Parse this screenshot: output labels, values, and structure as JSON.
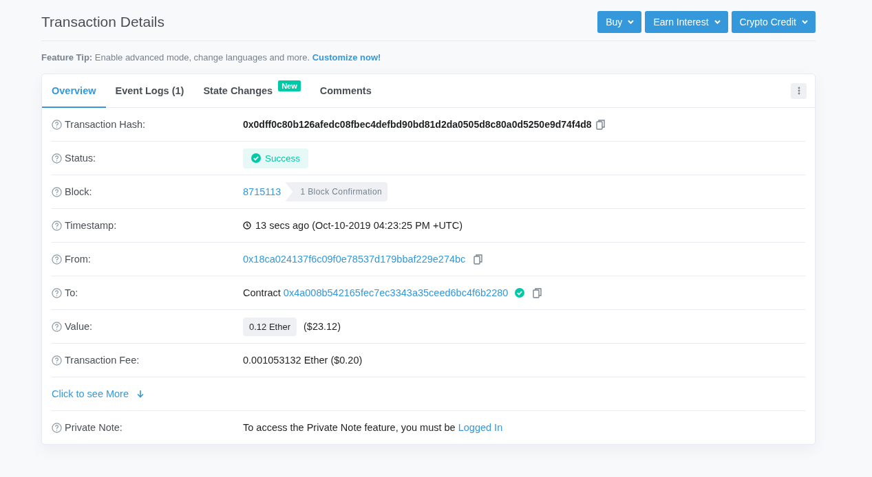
{
  "header": {
    "title": "Transaction Details",
    "buttons": [
      {
        "label": "Buy"
      },
      {
        "label": "Earn Interest"
      },
      {
        "label": "Crypto Credit"
      }
    ]
  },
  "tip": {
    "label": "Feature Tip:",
    "text": "Enable advanced mode, change languages and more.",
    "link": "Customize now!"
  },
  "tabs": [
    {
      "label": "Overview",
      "selected": true
    },
    {
      "label": "Event Logs (1)",
      "selected": false
    },
    {
      "label": "State Changes",
      "selected": false,
      "badge": "New"
    },
    {
      "label": "Comments",
      "selected": false
    }
  ],
  "rows": [
    {
      "kind": "hash",
      "label": "Transaction Hash:",
      "value": "0x0dff0c80b126afedc08fbec4defbd90bd81d2da0505d8c80a0d5250e9d74f4d8"
    },
    {
      "kind": "status",
      "label": "Status:",
      "value": "Success"
    },
    {
      "kind": "block",
      "label": "Block:",
      "value": "8715113",
      "note": "1 Block Confirmation"
    },
    {
      "kind": "time",
      "label": "Timestamp:",
      "value": "13 secs ago (Oct-10-2019 04:23:25 PM +UTC)"
    },
    {
      "kind": "address",
      "label": "From:",
      "value": "0x18ca024137f6c09f0e78537d179bbaf229e274bc"
    },
    {
      "kind": "contract",
      "label": "To:",
      "prefix": "Contract",
      "value": "0x4a008b542165fec7ec3343a35ceed6bc4f6b2280",
      "verified": true
    },
    {
      "kind": "value",
      "label": "Value:",
      "value": "0.12 Ether",
      "note": "($23.12)"
    },
    {
      "kind": "text",
      "label": "Transaction Fee:",
      "value": "0.001053132 Ether ($0.20)"
    },
    {
      "kind": "more",
      "label": "Click to see More"
    },
    {
      "kind": "note",
      "label": "Private Note:",
      "value": "To access the Private Note feature, you must be",
      "link": "Logged In"
    }
  ]
}
